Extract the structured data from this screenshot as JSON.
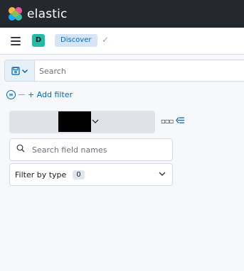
{
  "header": {
    "brand": "elastic"
  },
  "nav": {
    "space_initial": "D",
    "breadcrumb": "Discover"
  },
  "query": {
    "search_placeholder": "Search"
  },
  "filters": {
    "add_filter_label": "+ Add filter"
  },
  "sidebar": {
    "field_search_placeholder": "Search field names",
    "filter_by_type_label": "Filter by type",
    "filter_count": "0"
  },
  "colors": {
    "header_bg": "#25282f",
    "accent": "#006bb8",
    "space_avatar": "#1fbfa7"
  },
  "icons": [
    "elastic-logo-icon",
    "hamburger-menu-icon",
    "checkmark-icon",
    "saved-query-icon",
    "filter-options-icon",
    "options-dots-icon",
    "collapse-sidebar-icon",
    "magnifier-icon",
    "chevron-down-icon"
  ]
}
